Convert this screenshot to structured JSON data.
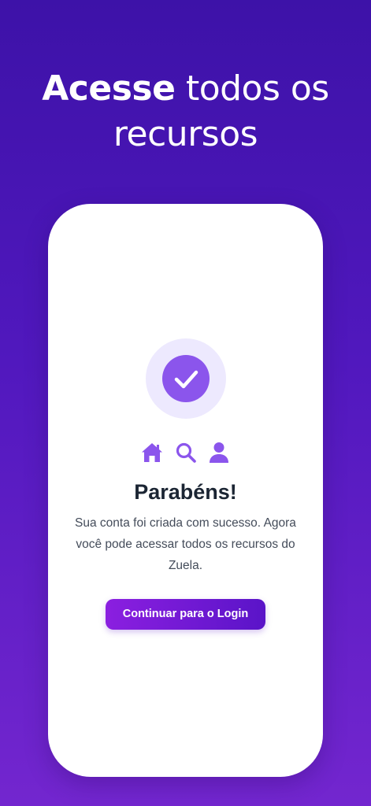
{
  "colors": {
    "background_top": "#3d12a8",
    "background_bottom": "#7326cf",
    "card": "#ffffff",
    "accent": "#8b55ec",
    "accent_light": "#ede9fe",
    "title_text": "#1b2533",
    "body_text": "#444c5a",
    "button_gradient_start": "#8b1fe0",
    "button_gradient_end": "#5a14c8"
  },
  "header": {
    "headline_bold": "Acesse",
    "headline_rest_line1": "todos os",
    "headline_line2": "recursos"
  },
  "card": {
    "success_icon": "check-circle-icon",
    "feature_icons": [
      "home-icon",
      "search-icon",
      "user-icon"
    ],
    "title": "Parabéns!",
    "message": "Sua conta foi criada com sucesso. Agora você pode acessar todos os recursos do Zuela.",
    "button_label": "Continuar para o Login"
  }
}
